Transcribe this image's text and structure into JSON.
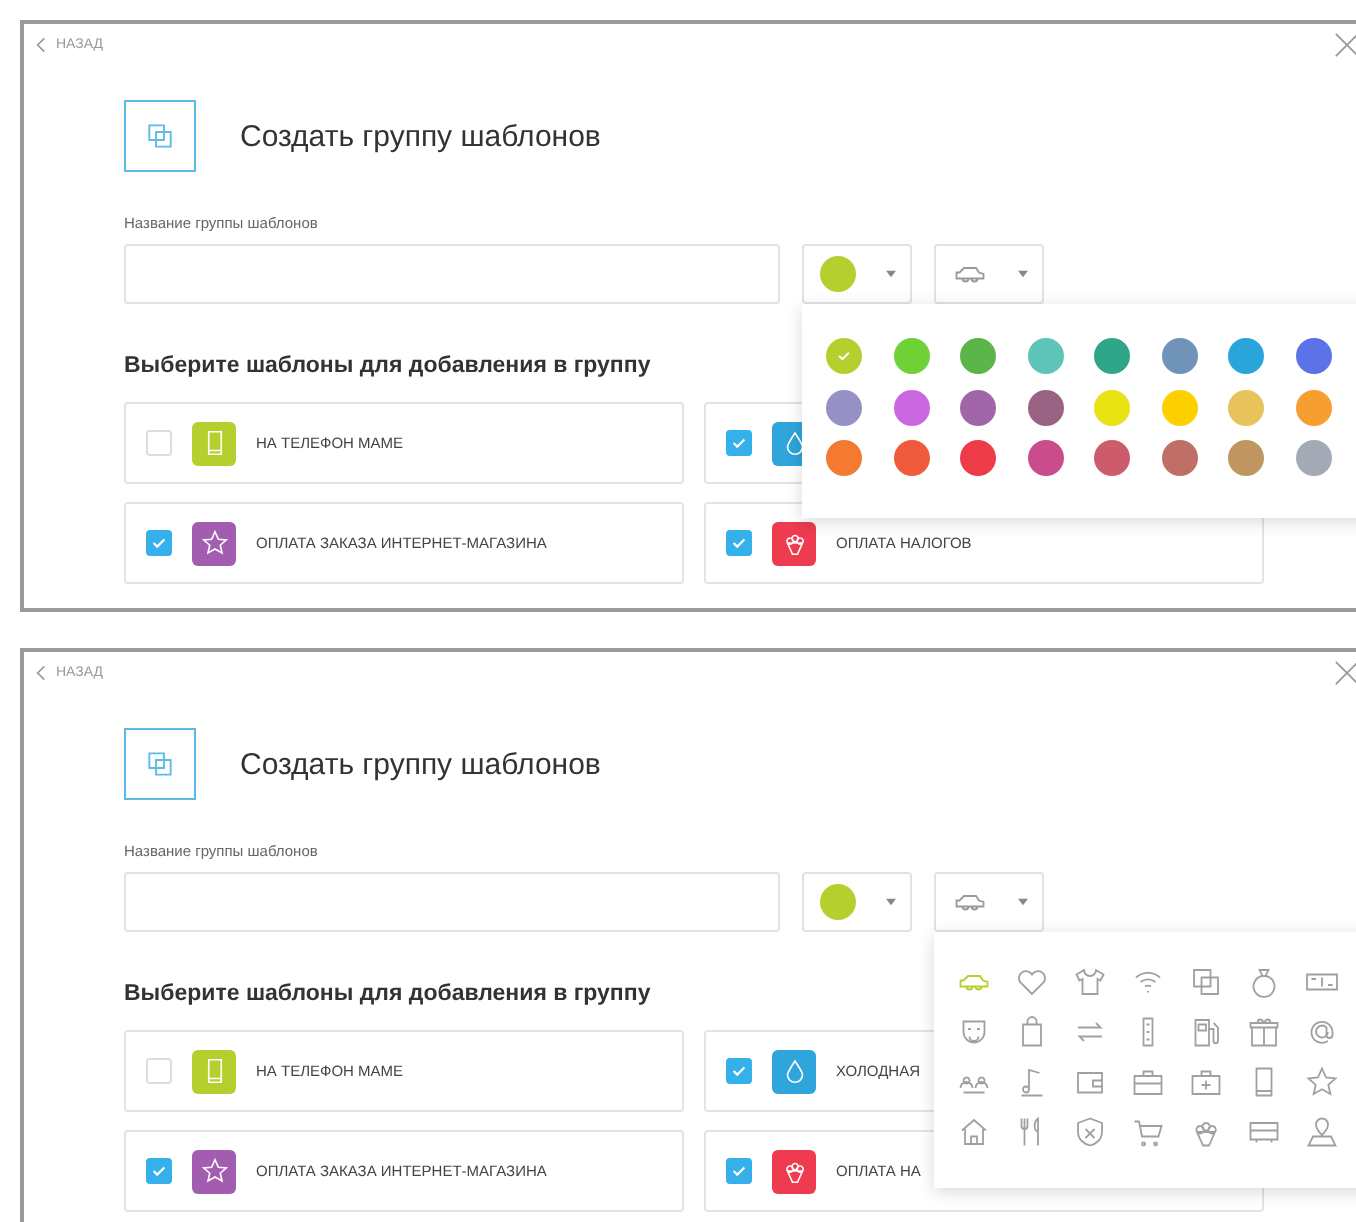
{
  "panels": [
    {
      "back": "НАЗАД",
      "title": "Создать группу шаблонов",
      "name_label": "Название группы шаблонов",
      "color_picker": {
        "color": "#b5cf2f"
      },
      "section_title": "Выберите шаблоны для добавления в группу",
      "templates": [
        {
          "name": "НА ТЕЛЕФОН МАМЕ",
          "checked": false,
          "color": "#b5cf2f"
        },
        {
          "checked": true,
          "color": "#2fa5dc"
        },
        {
          "name": "ОПЛАТА ЗАКАЗА ИНТЕРНЕТ-МАГАЗИНА",
          "checked": true,
          "color": "#a25cb0"
        },
        {
          "name": "ОПЛАТА НАЛОГОВ",
          "checked": true,
          "color": "#ee3b4f"
        }
      ],
      "popup": {
        "kind": "colors",
        "colors": [
          {
            "color": "#b5cf2f",
            "selected": true
          },
          {
            "color": "#6fd136",
            "selected": false
          },
          {
            "color": "#5bb548",
            "selected": false
          },
          {
            "color": "#5fc4b8",
            "selected": false
          },
          {
            "color": "#2fa687",
            "selected": false
          },
          {
            "color": "#6f94b8",
            "selected": false
          },
          {
            "color": "#2aa5dc",
            "selected": false
          },
          {
            "color": "#5b72e8",
            "selected": false
          },
          {
            "color": "#9591c4",
            "selected": false
          },
          {
            "color": "#c966e0",
            "selected": false
          },
          {
            "color": "#a066a8",
            "selected": false
          },
          {
            "color": "#996383",
            "selected": false
          },
          {
            "color": "#e8e313",
            "selected": false
          },
          {
            "color": "#fdd000",
            "selected": false
          },
          {
            "color": "#e8c35c",
            "selected": false
          },
          {
            "color": "#f79e32",
            "selected": false
          },
          {
            "color": "#f37a30",
            "selected": false
          },
          {
            "color": "#ef5a3c",
            "selected": false
          },
          {
            "color": "#ee3b48",
            "selected": false
          },
          {
            "color": "#c94d8a",
            "selected": false
          },
          {
            "color": "#cd5c6a",
            "selected": false
          },
          {
            "color": "#bf6f65",
            "selected": false
          },
          {
            "color": "#c0955f",
            "selected": false
          },
          {
            "color": "#a3aab5",
            "selected": false
          }
        ]
      }
    },
    {
      "back": "НАЗАД",
      "title": "Создать группу шаблонов",
      "name_label": "Название группы шаблонов",
      "color_picker": {
        "color": "#b5cf2f"
      },
      "section_title": "Выберите шаблоны для добавления в группу",
      "templates": [
        {
          "name": "НА ТЕЛЕФОН МАМЕ",
          "checked": false,
          "color": "#b5cf2f"
        },
        {
          "name": "ХОЛОДНАЯ",
          "checked": true,
          "color": "#2fa5dc"
        },
        {
          "name": "ОПЛАТА ЗАКАЗА ИНТЕРНЕТ-МАГАЗИНА",
          "checked": true,
          "color": "#a25cb0"
        },
        {
          "name": "ОПЛАТА НА",
          "checked": true,
          "color": "#ee3b4f"
        }
      ],
      "popup": {
        "kind": "icons",
        "icons": [
          {
            "selected": true
          },
          {
            "selected": false
          },
          {
            "selected": false
          },
          {
            "selected": false
          },
          {
            "selected": false
          },
          {
            "selected": false
          },
          {
            "selected": false
          },
          {
            "selected": false
          },
          {
            "selected": false
          },
          {
            "selected": false
          },
          {
            "selected": false
          },
          {
            "selected": false
          },
          {
            "selected": false
          },
          {
            "selected": false
          },
          {
            "selected": false
          },
          {
            "selected": false
          },
          {
            "selected": false
          },
          {
            "selected": false
          },
          {
            "selected": false
          },
          {
            "selected": false
          },
          {
            "selected": false
          },
          {
            "selected": false
          },
          {
            "selected": false
          },
          {
            "selected": false
          },
          {
            "selected": false
          },
          {
            "selected": false
          },
          {
            "selected": false
          },
          {
            "selected": false
          }
        ]
      }
    }
  ]
}
